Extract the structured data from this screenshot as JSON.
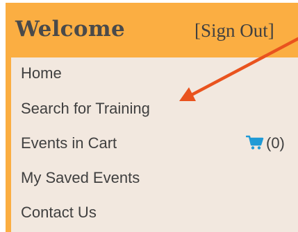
{
  "header": {
    "title": "Welcome",
    "sign_out_label": "[Sign Out]"
  },
  "menu": {
    "items": [
      {
        "label": "Home"
      },
      {
        "label": "Search for Training"
      },
      {
        "label": "Events in Cart",
        "count": "(0)"
      },
      {
        "label": "My Saved Events"
      },
      {
        "label": "Contact Us"
      }
    ]
  },
  "colors": {
    "header_background": "#fbae42",
    "menu_background": "#f2e8df",
    "cart_icon": "#1f9ad6",
    "annotation_arrow": "#e9531e"
  },
  "icons": {
    "cart": "shopping-cart-icon"
  }
}
